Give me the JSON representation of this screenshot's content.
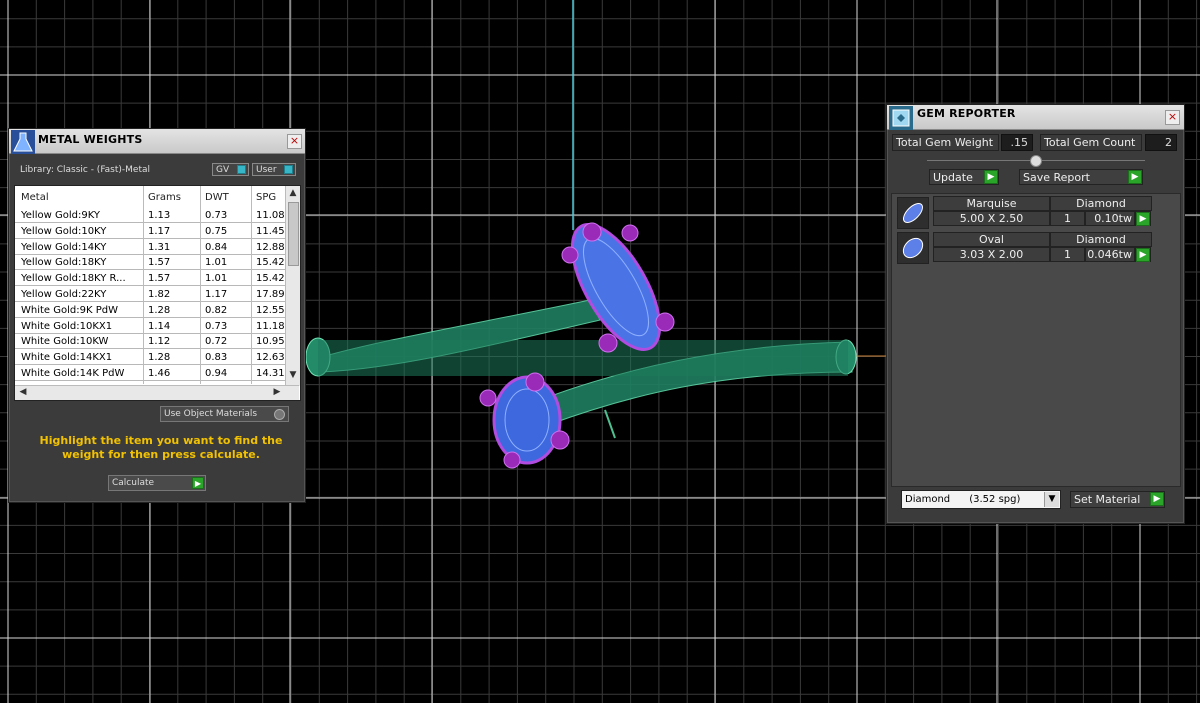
{
  "metal_weights": {
    "title": "METAL WEIGHTS",
    "library_label": "Library: Classic - (Fast)-Metal",
    "toggle_gv": "GV",
    "toggle_user": "User",
    "columns": [
      "Metal",
      "Grams",
      "DWT",
      "SPG"
    ],
    "rows": [
      {
        "metal": "Yellow Gold:9KY",
        "grams": "1.13",
        "dwt": "0.73",
        "spg": "11.08"
      },
      {
        "metal": "Yellow Gold:10KY",
        "grams": "1.17",
        "dwt": "0.75",
        "spg": "11.45"
      },
      {
        "metal": "Yellow Gold:14KY",
        "grams": "1.31",
        "dwt": "0.84",
        "spg": "12.88"
      },
      {
        "metal": "Yellow Gold:18KY",
        "grams": "1.57",
        "dwt": "1.01",
        "spg": "15.42"
      },
      {
        "metal": "Yellow Gold:18KY R...",
        "grams": "1.57",
        "dwt": "1.01",
        "spg": "15.42"
      },
      {
        "metal": "Yellow Gold:22KY",
        "grams": "1.82",
        "dwt": "1.17",
        "spg": "17.89"
      },
      {
        "metal": "White Gold:9K PdW",
        "grams": "1.28",
        "dwt": "0.82",
        "spg": "12.55"
      },
      {
        "metal": "White Gold:10KX1",
        "grams": "1.14",
        "dwt": "0.73",
        "spg": "11.18"
      },
      {
        "metal": "White Gold:10KW",
        "grams": "1.12",
        "dwt": "0.72",
        "spg": "10.95"
      },
      {
        "metal": "White Gold:14KX1",
        "grams": "1.28",
        "dwt": "0.83",
        "spg": "12.63"
      },
      {
        "metal": "White Gold:14K PdW",
        "grams": "1.46",
        "dwt": "0.94",
        "spg": "14.31"
      }
    ],
    "use_object_materials": "Use Object Materials",
    "instruction": "Highlight the item you want to find the weight for then press calculate.",
    "calculate_button": "Calculate"
  },
  "gem_reporter": {
    "title": "GEM REPORTER",
    "total_weight_label": "Total Gem Weight",
    "total_weight_value": ".15",
    "total_count_label": "Total Gem Count",
    "total_count_value": "2",
    "update_button": "Update",
    "save_report_button": "Save Report",
    "gems": [
      {
        "shape": "Marquise",
        "material": "Diamond",
        "size": "5.00 X 2.50",
        "count": "1",
        "weight": "0.10tw"
      },
      {
        "shape": "Oval",
        "material": "Diamond",
        "size": "3.03 X 2.00",
        "count": "1",
        "weight": "0.046tw"
      }
    ],
    "material_select": "Diamond      (3.52 spg)",
    "set_material_button": "Set Material"
  },
  "colors": {
    "ring_metal": "#1f8f6a",
    "gem_blue": "#3f6fe0",
    "prong_purple": "#a020c0",
    "accent_green": "#2aa52a",
    "instruction_yellow": "#f2c200"
  }
}
